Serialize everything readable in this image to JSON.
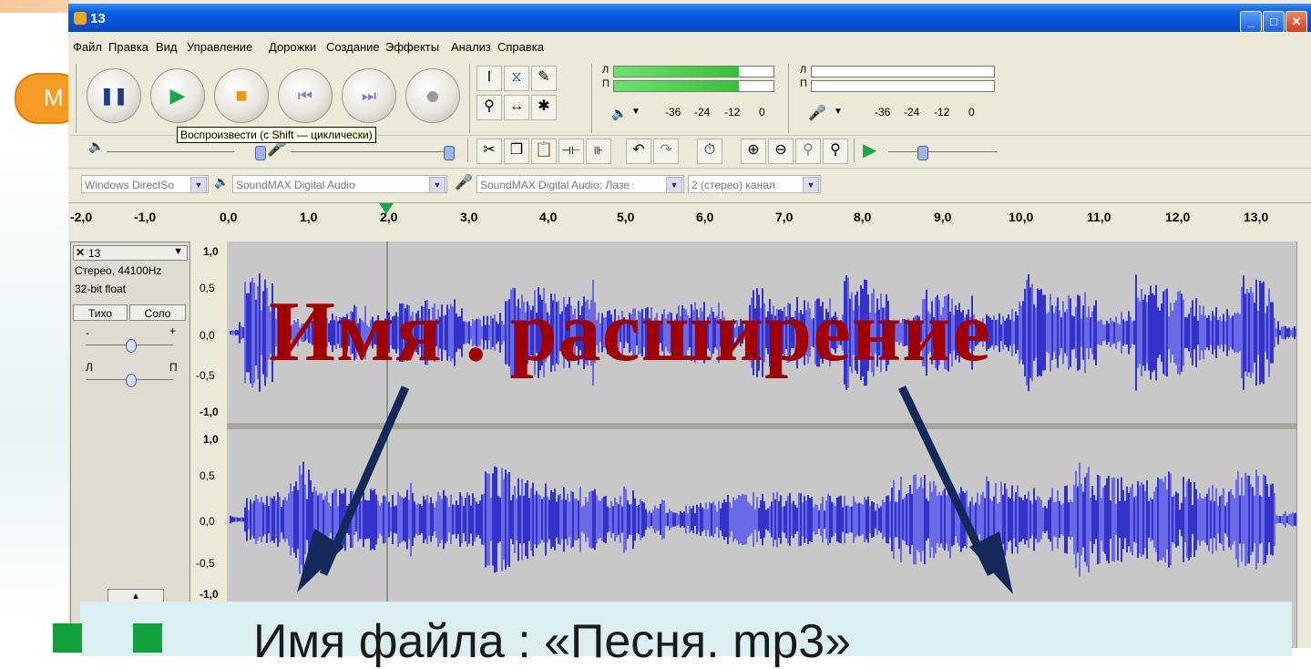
{
  "window": {
    "title": "13",
    "buttons": {
      "minimize": "_",
      "maximize": "□",
      "close": "✕"
    }
  },
  "menu": {
    "items": [
      "Файл",
      "Правка",
      "Вид",
      "Управление",
      "Дорожки",
      "Создание",
      "Эффекты",
      "Анализ",
      "Справка"
    ]
  },
  "transport": {
    "tooltip": "Воспроизвести (с Shift — циклически)",
    "icons": [
      "pause-icon",
      "play-icon",
      "stop-icon",
      "skip-start-icon",
      "skip-end-icon",
      "record-icon"
    ]
  },
  "meters": {
    "play_channel_l": "Л",
    "play_channel_r": "П",
    "rec_channel_l": "Л",
    "rec_channel_r": "П",
    "scale": [
      "-36",
      "-24",
      "-12",
      "0"
    ],
    "play_level_l": 0.78,
    "play_level_r": 0.78
  },
  "devices": {
    "host": "Windows DirectSo",
    "output": "SoundMAX Digital Audio",
    "input": "SoundMAX Digital Audio: Лазе",
    "channels": "2 (стерео) канал"
  },
  "ruler": {
    "ticks": [
      "-2,0",
      "-1,0",
      "0,0",
      "1,0",
      "2,0",
      "3,0",
      "4,0",
      "5,0",
      "6,0",
      "7,0",
      "8,0",
      "9,0",
      "10,0",
      "11,0",
      "12,0",
      "13,0"
    ]
  },
  "track": {
    "name": "13",
    "format": "Стерео, 44100Hz",
    "bits": "32-bit float",
    "mute": "Тихо",
    "solo": "Соло",
    "gain_minus": "-",
    "gain_plus": "+",
    "pan_left": "Л",
    "pan_right": "П",
    "scale": [
      "1,0",
      "0,5",
      "0,0",
      "-0,5",
      "-1,0"
    ],
    "scale2": [
      "1,0",
      "0,5",
      "0,0",
      "-0,5",
      "-1,0"
    ]
  },
  "slide": {
    "side_button": "M",
    "headline": "Имя . расширение",
    "caption": "Имя файла : «Песня. mp3»"
  },
  "colors": {
    "headline": "#a00000",
    "waveform": "#3333cc",
    "waveform_light": "#6a6ae6",
    "arrow": "#14285a",
    "caption_bg": "#dbeff0"
  }
}
